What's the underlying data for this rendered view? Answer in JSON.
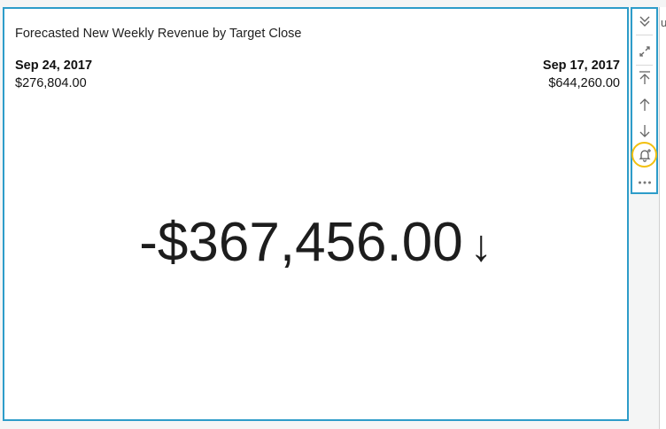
{
  "visual": {
    "title": "Forecasted New Weekly Revenue by Target Close",
    "current_period": {
      "date": "Sep 24, 2017",
      "value": "$276,804.00"
    },
    "previous_period": {
      "date": "Sep 17, 2017",
      "value": "$644,260.00"
    },
    "kpi_value": "-$367,456.00",
    "kpi_arrow": "↓"
  },
  "toolbar": {
    "items": [
      "collapse-menu-icon",
      "expand-icon",
      "move-to-top-icon",
      "move-up-icon",
      "move-down-icon",
      "alert-bell-icon",
      "more-options-icon"
    ]
  },
  "edge": {
    "text": "u"
  },
  "colors": {
    "selection_border": "#2d9cc9",
    "highlight_ring": "#f2c010"
  }
}
